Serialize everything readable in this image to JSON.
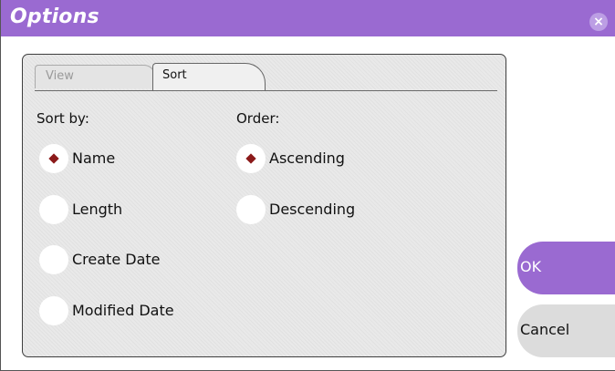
{
  "window": {
    "title": "Options",
    "close_symbol": "×"
  },
  "tabs": [
    {
      "label": "View",
      "selected": false
    },
    {
      "label": "Sort",
      "selected": true
    }
  ],
  "sort_by": {
    "heading": "Sort by:",
    "options": [
      {
        "label": "Name",
        "selected": true
      },
      {
        "label": "Length",
        "selected": false
      },
      {
        "label": "Create Date",
        "selected": false
      },
      {
        "label": "Modified Date",
        "selected": false
      }
    ]
  },
  "order": {
    "heading": "Order:",
    "options": [
      {
        "label": "Ascending",
        "selected": true
      },
      {
        "label": "Descending",
        "selected": false
      }
    ]
  },
  "buttons": {
    "ok": "OK",
    "cancel": "Cancel"
  },
  "colors": {
    "accent": "#9a6ad1",
    "radio_dot": "#8b1a1a",
    "panel_bg": "#e9e9e9"
  }
}
